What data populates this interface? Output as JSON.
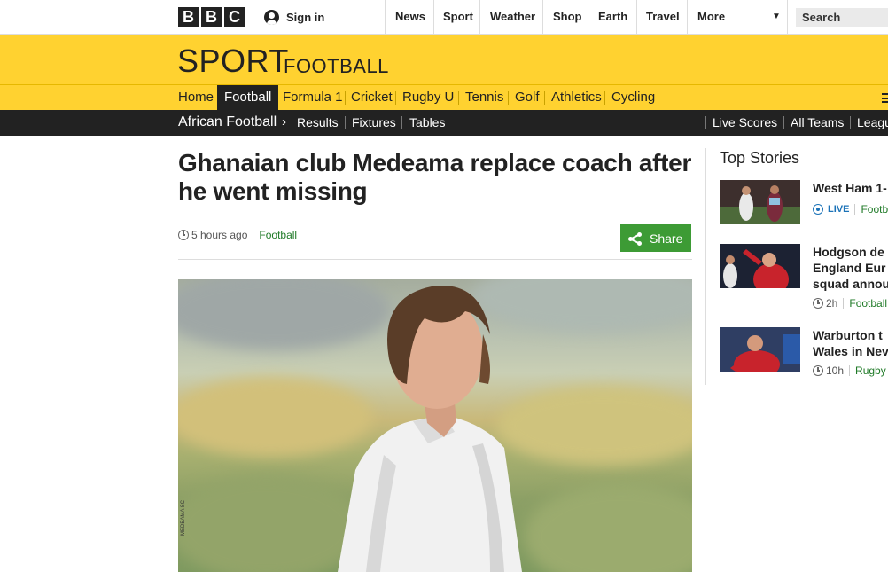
{
  "global_nav": {
    "logo_letters": [
      "B",
      "B",
      "C"
    ],
    "sign_in": "Sign in",
    "items": [
      "News",
      "Sport",
      "Weather",
      "Shop",
      "Earth",
      "Travel",
      "More"
    ],
    "search_placeholder": "Search"
  },
  "sport_header": {
    "title": "SPORT",
    "section": "FOOTBALL"
  },
  "sport_nav": {
    "items": [
      "Home",
      "Football",
      "Formula 1",
      "Cricket",
      "Rugby U",
      "Tennis",
      "Golf",
      "Athletics",
      "Cycling"
    ],
    "active": "Football"
  },
  "sub_nav": {
    "parent": "African Football",
    "items": [
      "Results",
      "Fixtures",
      "Tables"
    ],
    "right_items": [
      "Live Scores",
      "All Teams",
      "Leagu"
    ]
  },
  "article": {
    "headline_line1": "Ghanaian club Medeama replace coach after",
    "headline_line2": "he went missing",
    "time": "5 hours ago",
    "section": "Football",
    "share_label": "Share",
    "photo_credit": "MEDEAMA SC"
  },
  "top_stories": {
    "title": "Top Stories",
    "items": [
      {
        "title_lines": [
          "West Ham 1-"
        ],
        "live": "LIVE",
        "section": "Footba"
      },
      {
        "title_lines": [
          "Hodgson de",
          "England Eur",
          "squad annou"
        ],
        "time": "2h",
        "section": "Football"
      },
      {
        "title_lines": [
          "Warburton t",
          "Wales in Nev"
        ],
        "time": "10h",
        "section": "Rugby"
      }
    ]
  },
  "colors": {
    "brand_yellow": "#ffd230",
    "nav_black": "#222222",
    "share_green": "#3d9b35",
    "link_green": "#1f7a27",
    "live_blue": "#1c73b8"
  }
}
